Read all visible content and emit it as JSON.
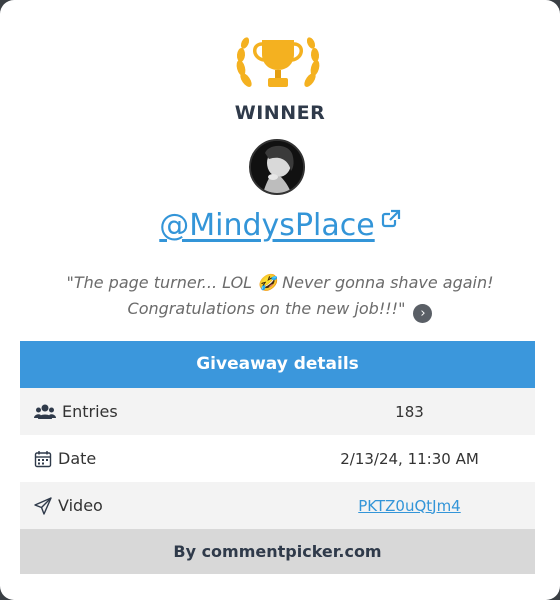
{
  "winner": {
    "label": "WINNER",
    "username": "@MindysPlace",
    "comment_before_emoji": "\"The page turner... LOL ",
    "emoji": "🤣",
    "comment_after_emoji": " Never gonna shave again! Congratulations on the new job!!!\""
  },
  "details": {
    "title": "Giveaway details",
    "rows": [
      {
        "label": "Entries",
        "value": "183",
        "icon": "users-icon"
      },
      {
        "label": "Date",
        "value": "2/13/24, 11:30 AM",
        "icon": "calendar-icon"
      },
      {
        "label": "Video",
        "value": "PKTZ0uQtJm4",
        "icon": "send-icon"
      }
    ]
  },
  "footer": {
    "text": "By commentpicker.com"
  },
  "colors": {
    "accent": "#3b97dc",
    "link": "#3395d8",
    "trophy": "#f4b120"
  }
}
